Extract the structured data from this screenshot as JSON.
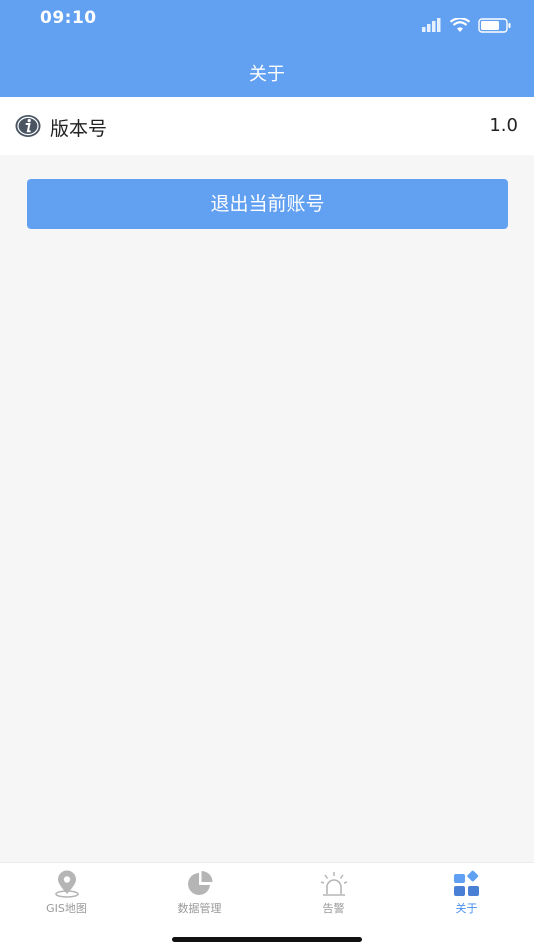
{
  "status_bar": {
    "time": "09:10"
  },
  "nav": {
    "title": "关于"
  },
  "version_row": {
    "icon": "info-icon",
    "label": "版本号",
    "value": "1.0"
  },
  "logout_button": {
    "label": "退出当前账号"
  },
  "tabbar": {
    "tabs": [
      {
        "label": "GIS地图",
        "icon": "map-pin-icon",
        "active": false
      },
      {
        "label": "数据管理",
        "icon": "pie-chart-icon",
        "active": false
      },
      {
        "label": "告警",
        "icon": "alarm-icon",
        "active": false
      },
      {
        "label": "关于",
        "icon": "grid-apps-icon",
        "active": true
      }
    ]
  },
  "colors": {
    "primary": "#62a0f2",
    "background": "#f6f6f6",
    "tab_inactive": "#9a9a9a",
    "tab_active": "#4a8ff0"
  }
}
